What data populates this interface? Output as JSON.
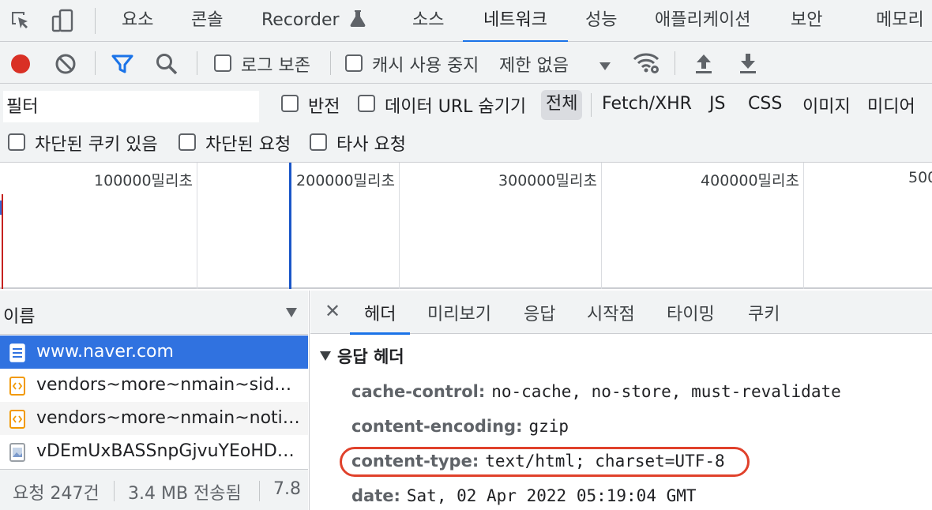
{
  "tabs": {
    "items": [
      "요소",
      "콘솔",
      "Recorder",
      "소스",
      "네트워크",
      "성능",
      "애플리케이션",
      "보안",
      "메모리"
    ],
    "active": "네트워크"
  },
  "toolbar": {
    "preserve_log_label": "로그 보존",
    "disable_cache_label": "캐시 사용 중지",
    "throttling_value": "제한 없음",
    "record_color": "#d93025",
    "filter_color": "#1a73e8"
  },
  "filterbar": {
    "placeholder": "필터",
    "invert_label": "반전",
    "hide_data_urls_label": "데이터 URL 숨기기",
    "types": [
      "전체",
      "Fetch/XHR",
      "JS",
      "CSS",
      "이미지",
      "미디어"
    ],
    "selected_type": "전체",
    "blocked_cookies_label": "차단된 쿠키 있음",
    "blocked_requests_label": "차단된 요청",
    "third_party_label": "타사 요청"
  },
  "timeline": {
    "labels": [
      "100000밀리초",
      "200000밀리초",
      "300000밀리초",
      "400000밀리초",
      "500"
    ]
  },
  "requests": {
    "column_name": "이름",
    "rows": [
      {
        "name": "www.naver.com",
        "icon": "document-icon",
        "selected": true
      },
      {
        "name": "vendors~more~nmain~sideb…",
        "icon": "script-icon",
        "selected": false
      },
      {
        "name": "vendors~more~nmain~notic…",
        "icon": "script-icon",
        "selected": false
      },
      {
        "name": "vDEmUxBASSnpGjvuYEoHD…",
        "icon": "image-icon",
        "selected": false
      }
    ],
    "status": {
      "requests": "요청 247건",
      "transferred": "3.4 MB 전송됨",
      "resources": "7.8"
    }
  },
  "detail": {
    "tabs": [
      "헤더",
      "미리보기",
      "응답",
      "시작점",
      "타이밍",
      "쿠키"
    ],
    "active_tab": "헤더",
    "section_title": "응답 헤더",
    "headers": [
      {
        "key": "cache-control:",
        "value": "no-cache, no-store, must-revalidate"
      },
      {
        "key": "content-encoding:",
        "value": "gzip"
      },
      {
        "key": "content-type:",
        "value": "text/html; charset=UTF-8"
      },
      {
        "key": "date:",
        "value": "Sat, 02 Apr 2022 05:19:04 GMT"
      }
    ],
    "highlight_color": "#e0412b"
  }
}
